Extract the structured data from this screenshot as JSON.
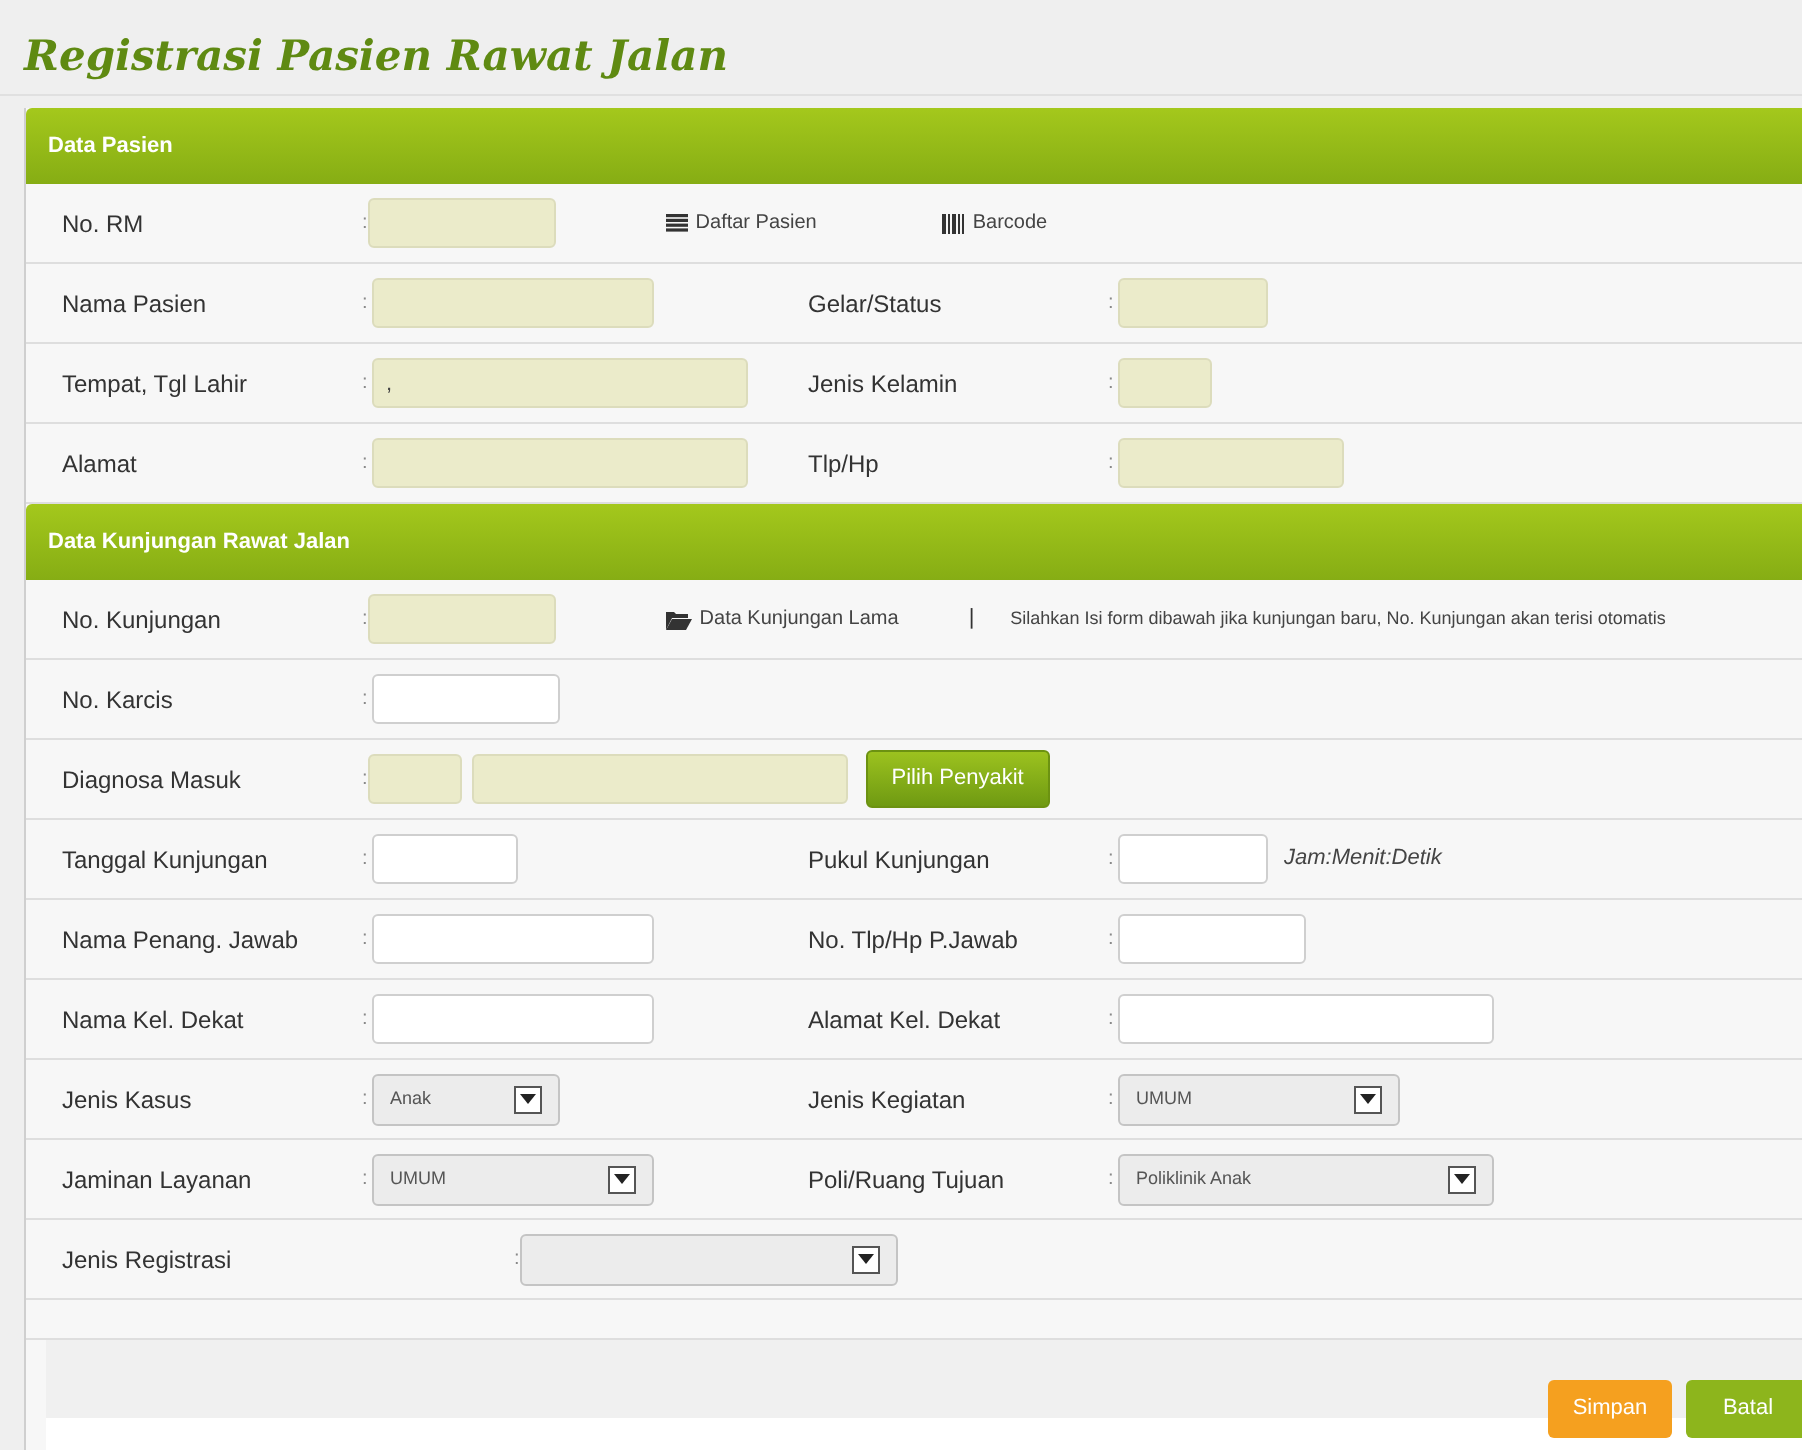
{
  "page": {
    "title": "Registrasi Pasien Rawat Jalan"
  },
  "sections": [
    {
      "title": "Data Pasien",
      "rows": [
        {
          "kind": "standard",
          "cells": [
            {
              "label": "No. RM",
              "colon": ":",
              "controls": [
                {
                  "kind": "input",
                  "readonly": true
                },
                {
                  "kind": "link",
                  "text": "Daftar Pasien"
                },
                {
                  "kind": "link",
                  "text": "Barcode"
                }
              ]
            }
          ]
        },
        {
          "kind": "standard",
          "cells": [
            {
              "label": "Nama Pasien",
              "colon": ":",
              "controls": [
                {
                  "kind": "input",
                  "readonly": true
                }
              ]
            },
            {
              "label": "Gelar/Status",
              "colon": ":",
              "controls": [
                {
                  "kind": "input",
                  "readonly": true
                }
              ]
            }
          ]
        },
        {
          "kind": "standard",
          "cells": [
            {
              "label": "Tempat, Tgl Lahir",
              "colon": ":",
              "controls": [
                {
                  "kind": "input",
                  "readonly": true,
                  "value": ","
                }
              ]
            },
            {
              "label": "Jenis Kelamin",
              "colon": ":",
              "controls": [
                {
                  "kind": "input",
                  "readonly": true
                }
              ]
            }
          ]
        },
        {
          "kind": "standard",
          "cells": [
            {
              "label": "Alamat",
              "colon": ":",
              "controls": [
                {
                  "kind": "input",
                  "readonly": true
                }
              ]
            },
            {
              "label": "Tlp/Hp",
              "colon": ":",
              "controls": [
                {
                  "kind": "input",
                  "readonly": true
                }
              ]
            }
          ]
        }
      ]
    },
    {
      "title": "Data Kunjungan Rawat Jalan",
      "rows": [
        {
          "kind": "standard",
          "cells": [
            {
              "label": "No. Kunjungan",
              "colon": ":",
              "controls": [
                {
                  "kind": "input",
                  "readonly": true
                },
                {
                  "kind": "link",
                  "text": "Data Kunjungan Lama"
                },
                {
                  "kind": "separator",
                  "text": "|"
                },
                {
                  "kind": "note",
                  "text": "Silahkan Isi form dibawah jika kunjungan baru, No. Kunjungan akan terisi otomatis"
                }
              ]
            }
          ]
        },
        {
          "kind": "standard",
          "cells": [
            {
              "label": "No. Karcis",
              "colon": ":",
              "controls": [
                {
                  "kind": "input",
                  "readonly": false
                }
              ]
            }
          ]
        },
        {
          "kind": "standard",
          "cells": [
            {
              "label": "Diagnosa Masuk",
              "colon": ":",
              "controls": [
                {
                  "kind": "input",
                  "readonly": true
                },
                {
                  "kind": "input",
                  "readonly": true
                },
                {
                  "kind": "button",
                  "text": "Pilih Penyakit"
                }
              ]
            }
          ]
        },
        {
          "kind": "standard",
          "cells": [
            {
              "label": "Tanggal Kunjungan",
              "colon": ":",
              "controls": [
                {
                  "kind": "input",
                  "readonly": false
                }
              ]
            },
            {
              "label": "Pukul Kunjungan",
              "colon": ":",
              "controls": [
                {
                  "kind": "input",
                  "readonly": false
                },
                {
                  "kind": "hint",
                  "text": "Jam:Menit:Detik"
                }
              ]
            }
          ]
        },
        {
          "kind": "standard",
          "cells": [
            {
              "label": "Nama Penang. Jawab",
              "colon": ":",
              "controls": [
                {
                  "kind": "input",
                  "readonly": false
                }
              ]
            },
            {
              "label": "No. Tlp/Hp P.Jawab",
              "colon": ":",
              "controls": [
                {
                  "kind": "input",
                  "readonly": false
                }
              ]
            }
          ]
        },
        {
          "kind": "standard",
          "cells": [
            {
              "label": "Nama Kel. Dekat",
              "colon": ":",
              "controls": [
                {
                  "kind": "input",
                  "readonly": false
                }
              ]
            },
            {
              "label": "Alamat Kel. Dekat",
              "colon": ":",
              "controls": [
                {
                  "kind": "input",
                  "readonly": false
                }
              ]
            }
          ]
        },
        {
          "kind": "standard",
          "cells": [
            {
              "label": "Jenis Kasus",
              "colon": ":",
              "controls": [
                {
                  "kind": "select",
                  "value": "Anak"
                }
              ]
            },
            {
              "label": "Jenis Kegiatan",
              "colon": ":",
              "controls": [
                {
                  "kind": "select",
                  "value": "UMUM"
                }
              ]
            }
          ]
        },
        {
          "kind": "standard",
          "cells": [
            {
              "label": "Jaminan Layanan",
              "colon": ":",
              "controls": [
                {
                  "kind": "select",
                  "value": "UMUM"
                }
              ]
            },
            {
              "label": "Poli/Ruang Tujuan",
              "colon": ":",
              "controls": [
                {
                  "kind": "select",
                  "value": "Poliklinik Anak"
                }
              ]
            }
          ]
        },
        {
          "kind": "offset",
          "cells": [
            {
              "label": "Jenis Registrasi",
              "colon": ":",
              "controls": [
                {
                  "kind": "select"
                }
              ]
            }
          ]
        }
      ]
    }
  ],
  "footer": {
    "buttons": [
      {
        "text": "Simpan",
        "color": "#f5a01f"
      },
      {
        "text": "Batal",
        "color": "#8db51c"
      }
    ]
  }
}
